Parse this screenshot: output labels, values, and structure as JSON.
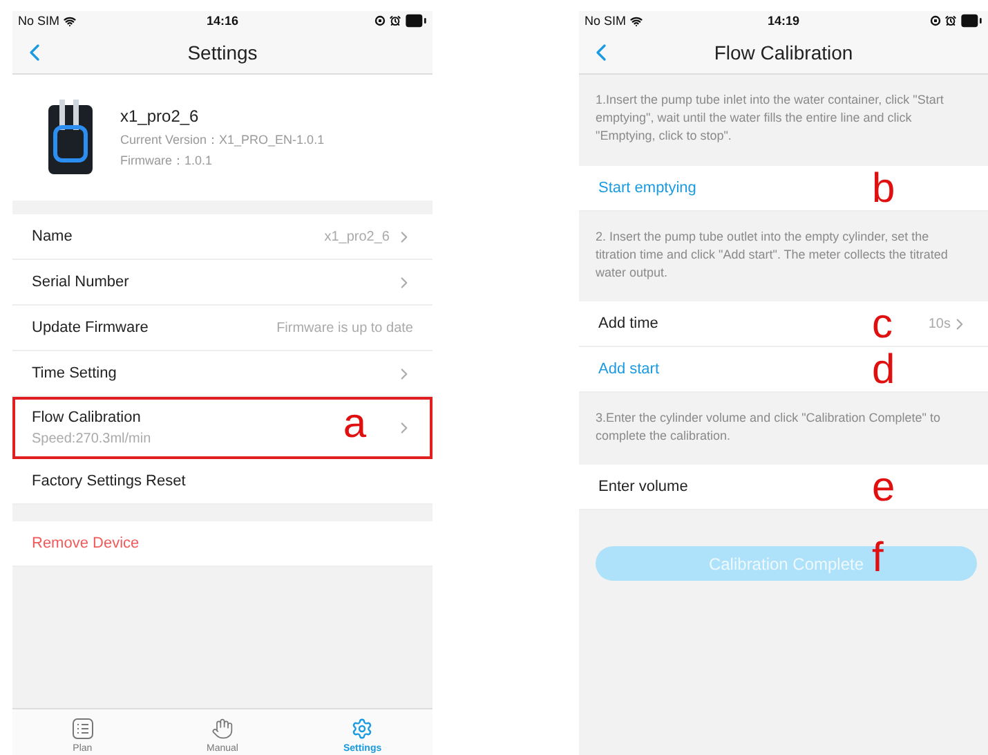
{
  "settings_screen": {
    "status_bar": {
      "carrier": "No SIM",
      "time": "14:16"
    },
    "title": "Settings",
    "device": {
      "name": "x1_pro2_6",
      "version": "Current Version：X1_PRO_EN-1.0.1",
      "firmware": "Firmware：1.0.1"
    },
    "rows": [
      {
        "label": "Name",
        "value": "x1_pro2_6",
        "chevron": true
      },
      {
        "label": "Serial Number",
        "chevron": true
      },
      {
        "label": "Update Firmware",
        "value": "Firmware is up to date",
        "chevron": false
      },
      {
        "label": "Time Setting",
        "chevron": true
      },
      {
        "label": "Flow Calibration",
        "subtitle": "Speed:270.3ml/min",
        "chevron": true,
        "annotation": "a",
        "outlined": true
      },
      {
        "label": "Factory Settings Reset",
        "chevron": false
      }
    ],
    "remove_label": "Remove Device",
    "tabs": [
      {
        "label": "Plan",
        "kind": "list",
        "selected": false
      },
      {
        "label": "Manual",
        "kind": "hand",
        "selected": false
      },
      {
        "label": "Settings",
        "kind": "gear",
        "selected": true
      }
    ]
  },
  "calibration_screen": {
    "status_bar": {
      "carrier": "No SIM",
      "time": "14:19"
    },
    "title": "Flow Calibration",
    "items": [
      {
        "kind": "instruction",
        "text": "1.Insert the pump tube inlet into the water container, click \"Start emptying\", wait until the water fills the entire line and click \"Emptying, click to stop\"."
      },
      {
        "kind": "action",
        "label": "Start emptying",
        "annotation": "b"
      },
      {
        "kind": "instruction",
        "text": "2. Insert the pump tube outlet into the empty cylinder, set the titration time and click \"Add start\". The meter collects the titrated water output."
      },
      {
        "kind": "field",
        "label": "Add time",
        "value": "10s",
        "annotation": "c"
      },
      {
        "kind": "action",
        "label": "Add start",
        "annotation": "d"
      },
      {
        "kind": "instruction",
        "text": "3.Enter the cylinder volume and click \"Calibration Complete\" to complete the calibration."
      },
      {
        "kind": "input",
        "label": "Enter volume",
        "annotation": "e"
      }
    ],
    "button": {
      "label": "Calibration Complete",
      "disabled": true,
      "annotation": "f"
    }
  }
}
